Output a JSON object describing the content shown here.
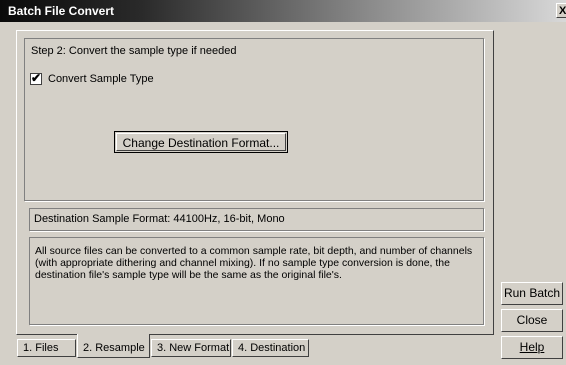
{
  "window": {
    "title": "Batch File Convert",
    "close_label": "X"
  },
  "step": {
    "label": "Step 2:  Convert the sample type if needed"
  },
  "convert_checkbox": {
    "label": "Convert Sample Type",
    "checked": true,
    "mark": "✔"
  },
  "change_button": {
    "label": "Change Destination Format..."
  },
  "destination_format": {
    "text": "Destination Sample Format: 44100Hz, 16-bit, Mono"
  },
  "description": {
    "text": "All source files can be converted to a common sample rate, bit depth, and number of channels (with appropriate dithering and channel mixing).  If no sample type conversion is done, the destination file's sample type will be the same as the original file's."
  },
  "tabs": [
    {
      "label": "1. Files",
      "active": false
    },
    {
      "label": "2. Resample",
      "active": true
    },
    {
      "label": "3. New Format",
      "active": false
    },
    {
      "label": "4. Destination",
      "active": false
    }
  ],
  "side_buttons": {
    "run_batch": "Run Batch",
    "close": "Close",
    "help": "Help"
  }
}
